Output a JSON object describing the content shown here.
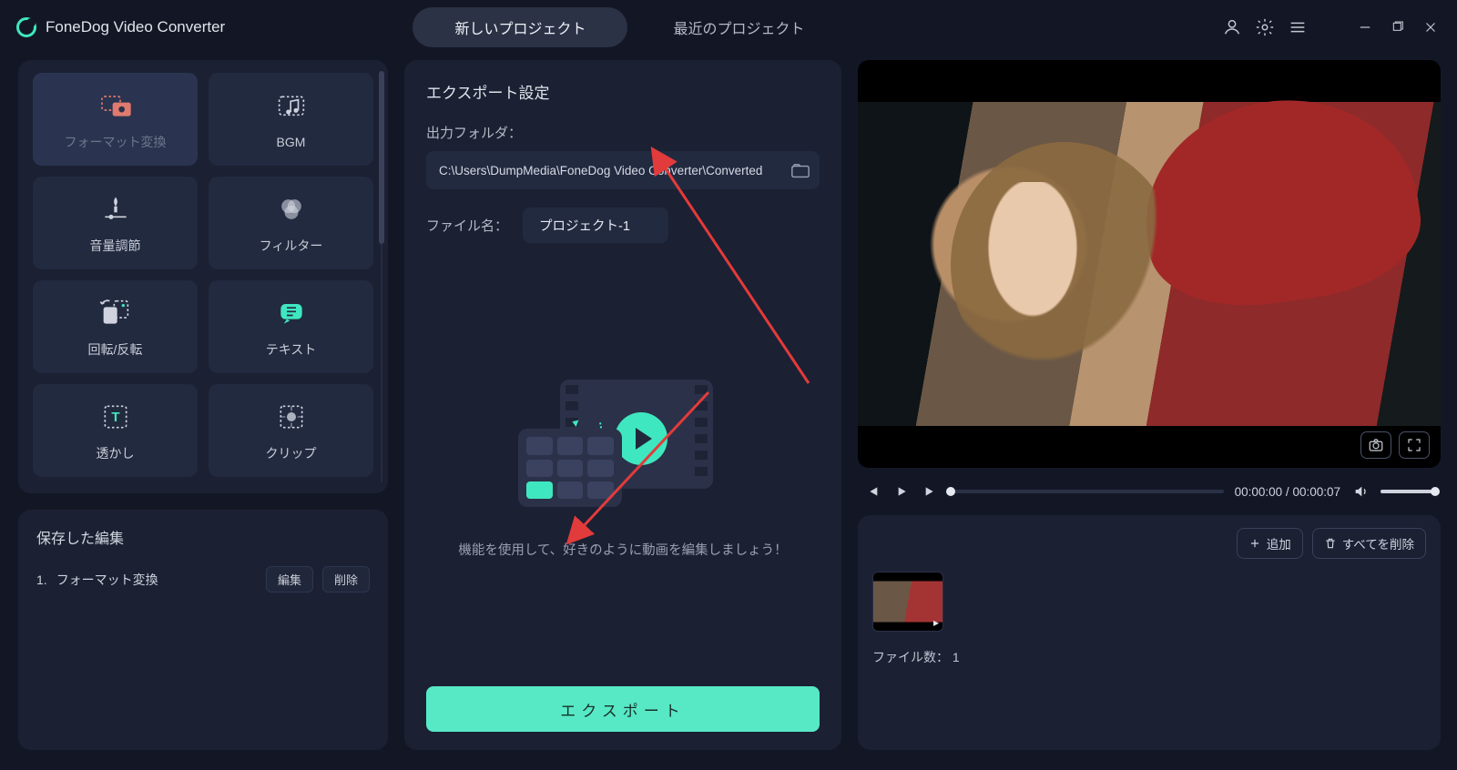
{
  "app": {
    "title": "FoneDog Video Converter"
  },
  "tabs": {
    "new_project": "新しいプロジェクト",
    "recent_projects": "最近のプロジェクト"
  },
  "tools": {
    "format_convert": "フォーマット変換",
    "bgm": "BGM",
    "volume": "音量調節",
    "filter": "フィルター",
    "rotate_flip": "回転/反転",
    "text": "テキスト",
    "watermark": "透かし",
    "clip": "クリップ"
  },
  "saved": {
    "title": "保存した編集",
    "items": [
      {
        "index": "1.",
        "name": "フォーマット変換"
      }
    ],
    "edit_label": "編集",
    "delete_label": "削除"
  },
  "export": {
    "heading": "エクスポート設定",
    "output_folder_label": "出力フォルダ：",
    "output_folder_path": "C:\\Users\\DumpMedia\\FoneDog Video Converter\\Converted",
    "filename_label": "ファイル名：",
    "filename_value": "プロジェクト-1",
    "hint": "機能を使用して、好きのように動画を編集しましょう！",
    "button": "エクスポート"
  },
  "player": {
    "current_time": "00:00:00",
    "duration": "00:00:07"
  },
  "playlist": {
    "add_label": "追加",
    "clear_label": "すべてを削除",
    "file_count_label": "ファイル数：",
    "file_count_value": "1"
  }
}
